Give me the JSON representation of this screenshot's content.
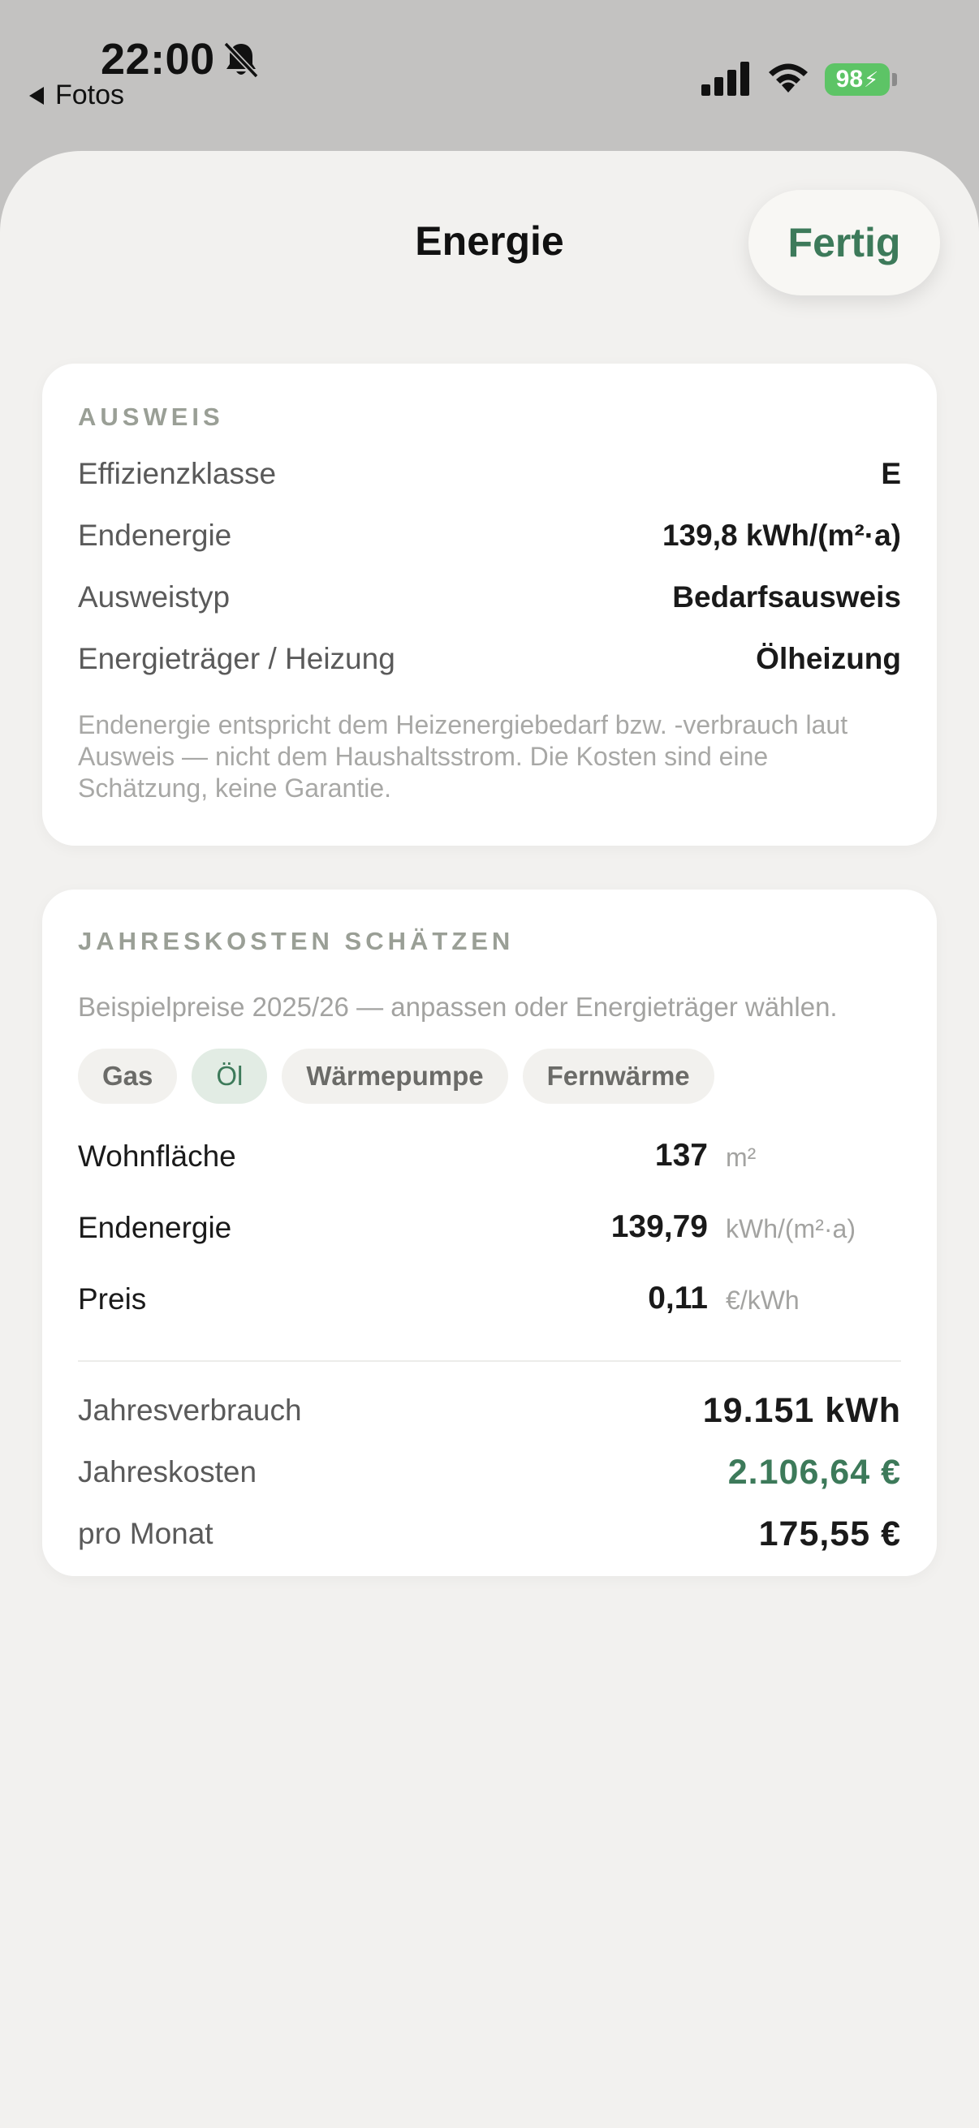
{
  "status_bar": {
    "time": "22:00",
    "back_app": "Fotos",
    "battery": "98"
  },
  "header": {
    "title": "Energie",
    "done_label": "Fertig"
  },
  "certificate": {
    "section_label": "AUSWEIS",
    "rows": [
      {
        "label": "Effizienzklasse",
        "value": "E"
      },
      {
        "label": "Endenergie",
        "value": "139,8 kWh/(m²·a)"
      },
      {
        "label": "Ausweistyp",
        "value": "Bedarfsausweis"
      },
      {
        "label": "Energieträger / Heizung",
        "value": "Ölheizung"
      }
    ],
    "note": "Endenergie entspricht dem Heizenergiebedarf bzw. -verbrauch laut Ausweis — nicht dem Haushaltsstrom. Die Kosten sind eine Schätzung, keine Garantie."
  },
  "estimate": {
    "section_label": "JAHRESKOSTEN SCHÄTZEN",
    "subtitle": "Beispielpreise 2025/26 — anpassen oder Energieträger wählen.",
    "chips": [
      {
        "label": "Gas",
        "active": false
      },
      {
        "label": "Öl",
        "active": true
      },
      {
        "label": "Wärmepumpe",
        "active": false
      },
      {
        "label": "Fernwärme",
        "active": false
      }
    ],
    "inputs": [
      {
        "label": "Wohnfläche",
        "value": "137",
        "unit": "m²"
      },
      {
        "label": "Endenergie",
        "value": "139,79",
        "unit": "kWh/(m²·a)"
      },
      {
        "label": "Preis",
        "value": "0,11",
        "unit": "€/kWh"
      }
    ],
    "results": [
      {
        "label": "Jahresverbrauch",
        "value": "19.151 kWh"
      },
      {
        "label": "Jahreskosten",
        "value": "2.106,64 €"
      },
      {
        "label": "pro Monat",
        "value": "175,55 €"
      }
    ]
  },
  "colors": {
    "accent": "#3d7a5a",
    "battery": "#5dc466",
    "sheet_bg": "#f2f1ef",
    "section_label": "#9a9f96"
  },
  "icons": [
    "bell-slash-icon",
    "back-triangle-icon",
    "cellular-signal-icon",
    "wifi-icon",
    "battery-charging-icon"
  ]
}
